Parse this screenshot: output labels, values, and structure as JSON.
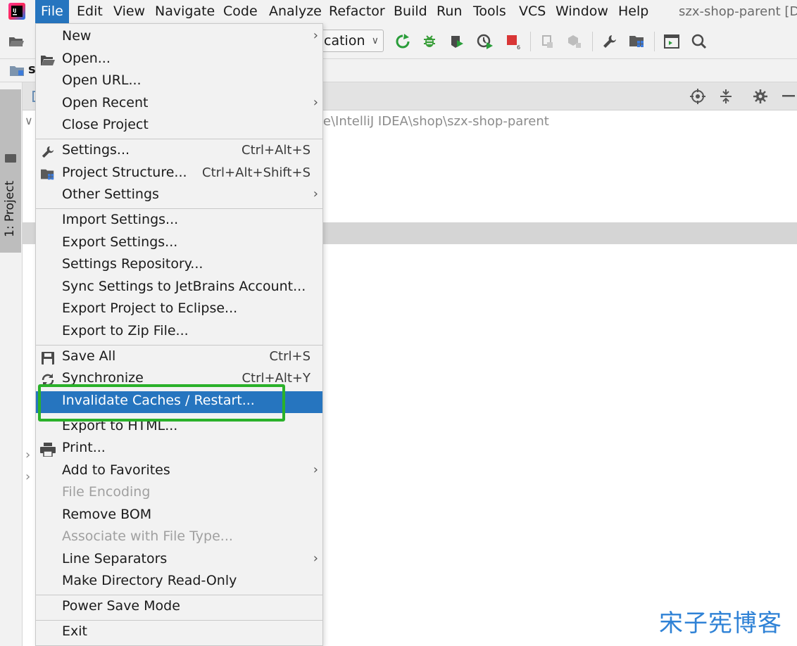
{
  "menubar": {
    "items": [
      "File",
      "Edit",
      "View",
      "Navigate",
      "Code",
      "Analyze",
      "Refactor",
      "Build",
      "Run",
      "Tools",
      "VCS",
      "Window",
      "Help"
    ],
    "active": "File",
    "window_title": "szx-shop-parent [D:"
  },
  "toolbar": {
    "run_config": "cation",
    "icons": [
      "open-folder-icon",
      "rerun-icon",
      "debug-icon",
      "coverage-icon",
      "profile-icon",
      "stop-icon",
      "build-icon",
      "project-structure-icon",
      "wrench-icon",
      "sdk-folder-icon",
      "terminal-icon",
      "search-icon"
    ],
    "stop_badge": "6"
  },
  "navbar": {
    "project": "s"
  },
  "sidebar": {
    "tab_label": "1: Project"
  },
  "project_panel": {
    "path_fragment": "ce\\IntelliJ IDEA\\shop\\szx-shop-parent"
  },
  "file_menu": {
    "groups": [
      [
        {
          "label": "New",
          "submenu": true
        },
        {
          "label": "Open...",
          "icon": "folder-open-icon"
        },
        {
          "label": "Open URL..."
        },
        {
          "label": "Open Recent",
          "submenu": true
        },
        {
          "label": "Close Project"
        }
      ],
      [
        {
          "label": "Settings...",
          "shortcut": "Ctrl+Alt+S",
          "icon": "wrench-icon"
        },
        {
          "label": "Project Structure...",
          "shortcut": "Ctrl+Alt+Shift+S",
          "icon": "project-structure-icon"
        },
        {
          "label": "Other Settings",
          "submenu": true
        }
      ],
      [
        {
          "label": "Import Settings..."
        },
        {
          "label": "Export Settings..."
        },
        {
          "label": "Settings Repository..."
        },
        {
          "label": "Sync Settings to JetBrains Account..."
        },
        {
          "label": "Export Project to Eclipse..."
        },
        {
          "label": "Export to Zip File..."
        }
      ],
      [
        {
          "label": "Save All",
          "shortcut": "Ctrl+S",
          "icon": "save-icon"
        },
        {
          "label": "Synchronize",
          "shortcut": "Ctrl+Alt+Y",
          "icon": "sync-icon"
        },
        {
          "label": "Invalidate Caches / Restart...",
          "highlighted": true
        },
        {
          "label": "Export to HTML..."
        },
        {
          "label": "Print...",
          "icon": "print-icon"
        },
        {
          "label": "Add to Favorites",
          "submenu": true
        },
        {
          "label": "File Encoding",
          "disabled": true
        },
        {
          "label": "Remove BOM"
        },
        {
          "label": "Associate with File Type...",
          "disabled": true
        },
        {
          "label": "Line Separators",
          "submenu": true
        },
        {
          "label": "Make Directory Read-Only"
        }
      ],
      [
        {
          "label": "Power Save Mode"
        }
      ],
      [
        {
          "label": "Exit"
        }
      ]
    ]
  },
  "colors": {
    "highlight": "#2675bf",
    "annotation_box": "#2ab12a",
    "watermark": "#2f82d6"
  },
  "watermark": "宋子宪博客"
}
